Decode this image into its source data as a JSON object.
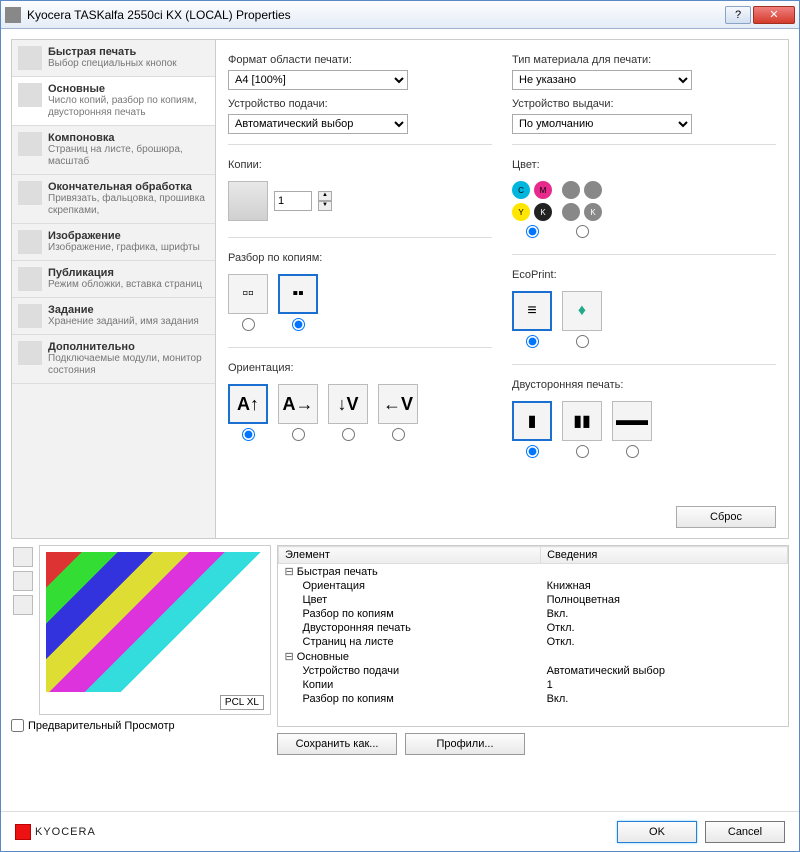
{
  "window": {
    "title": "Kyocera TASKalfa 2550ci KX (LOCAL) Properties"
  },
  "sidebar": {
    "items": [
      {
        "title": "Быстрая печать",
        "desc": "Выбор специальных кнопок"
      },
      {
        "title": "Основные",
        "desc": "Число копий, разбор по копиям, двусторонняя печать"
      },
      {
        "title": "Компоновка",
        "desc": "Страниц на листе, брошюра, масштаб"
      },
      {
        "title": "Окончательная обработка",
        "desc": "Привязать, фальцовка, прошивка скрепками,"
      },
      {
        "title": "Изображение",
        "desc": "Изображение, графика, шрифты"
      },
      {
        "title": "Публикация",
        "desc": "Режим обложки, вставка страниц"
      },
      {
        "title": "Задание",
        "desc": "Хранение заданий, имя задания"
      },
      {
        "title": "Дополнительно",
        "desc": "Подключаемые модули, монитор состояния"
      }
    ]
  },
  "main": {
    "print_area_label": "Формат области печати:",
    "print_area_value": "A4  [100%]",
    "feed_label": "Устройство подачи:",
    "feed_value": "Автоматический выбор",
    "copies_label": "Копии:",
    "copies_value": "1",
    "collate_label": "Разбор по копиям:",
    "orientation_label": "Ориентация:",
    "media_label": "Тип материала для печати:",
    "media_value": "Не указано",
    "output_label": "Устройство выдачи:",
    "output_value": "По умолчанию",
    "color_label": "Цвет:",
    "ecoprint_label": "EcoPrint:",
    "duplex_label": "Двусторонняя печать:",
    "reset": "Сброс"
  },
  "preview": {
    "badge": "PCL XL",
    "checkbox": "Предварительный Просмотр"
  },
  "table": {
    "headers": {
      "element": "Элемент",
      "value": "Сведения"
    },
    "groups": [
      {
        "name": "Быстрая печать",
        "rows": [
          {
            "k": "Ориентация",
            "v": "Книжная"
          },
          {
            "k": "Цвет",
            "v": "Полноцветная"
          },
          {
            "k": "Разбор по копиям",
            "v": "Вкл."
          },
          {
            "k": "Двусторонняя печать",
            "v": "Откл."
          },
          {
            "k": "Страниц на листе",
            "v": "Откл."
          }
        ]
      },
      {
        "name": "Основные",
        "rows": [
          {
            "k": "Устройство подачи",
            "v": "Автоматический выбор"
          },
          {
            "k": "Копии",
            "v": "1"
          },
          {
            "k": "Разбор по копиям",
            "v": "Вкл."
          }
        ]
      }
    ]
  },
  "buttons": {
    "save_as": "Сохранить как...",
    "profiles": "Профили..."
  },
  "footer": {
    "brand": "KYOCERA",
    "ok": "OK",
    "cancel": "Cancel"
  }
}
